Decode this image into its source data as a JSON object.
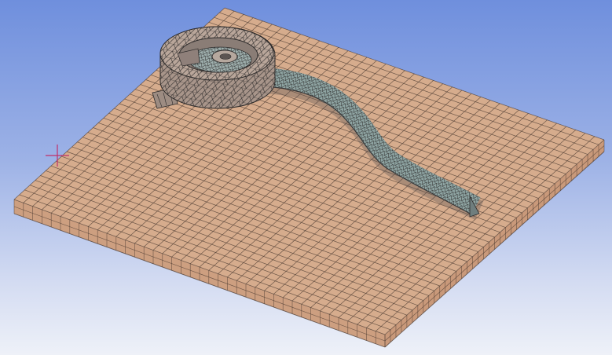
{
  "viewport": {
    "kind": "3d-mesh-view",
    "background_top": "#6f8fdd",
    "background_bottom": "#eef1f8"
  },
  "plate": {
    "top_color": "#d6ac8d",
    "side_color": "#cd9f80",
    "mesh_line_color": "#4a3a30",
    "grid_divisions": 40
  },
  "part": {
    "ring_color": "#a8958a",
    "tube_color": "#8fa5a3",
    "mesh_line_color": "#2c2a2a"
  },
  "triad": {
    "icon": "crosshair-icon",
    "color": "#c0306a"
  }
}
